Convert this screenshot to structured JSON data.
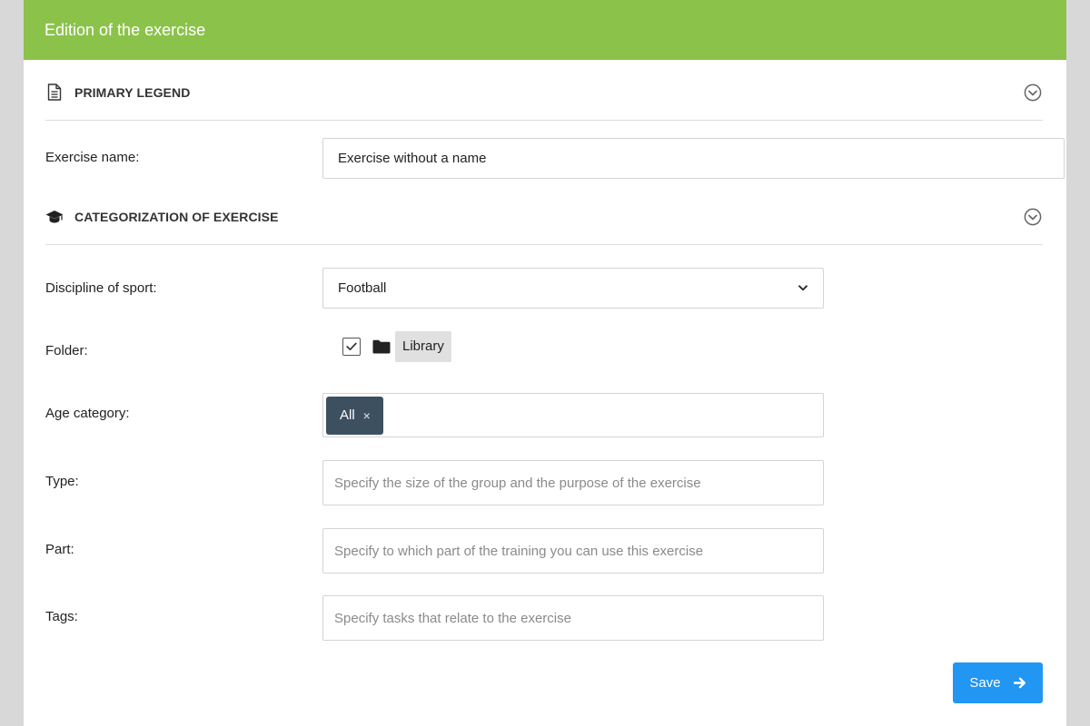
{
  "header": {
    "title": "Edition of the exercise",
    "background_color": "#8bc34a"
  },
  "sections": {
    "primary": {
      "title": "PRIMARY LEGEND",
      "icon": "document-icon",
      "toggle_icon": "chevron-circle-down-icon"
    },
    "categorization": {
      "title": "CATEGORIZATION OF EXERCISE",
      "icon": "graduation-cap-icon",
      "toggle_icon": "chevron-circle-down-icon"
    }
  },
  "fields": {
    "exercise_name": {
      "label": "Exercise name:",
      "value": "Exercise without a name"
    },
    "discipline": {
      "label": "Discipline of sport:",
      "selected": "Football",
      "icon": "chevron-down-icon"
    },
    "folder": {
      "label": "Folder:",
      "checked": true,
      "icon": "folder-icon",
      "name": "Library"
    },
    "age_category": {
      "label": "Age category:",
      "chips": [
        {
          "label": "All",
          "remove": "×"
        }
      ],
      "chip_color": "#3d5060"
    },
    "type": {
      "label": "Type:",
      "placeholder": "Specify the size of the group and the purpose of the exercise"
    },
    "part": {
      "label": "Part:",
      "placeholder": "Specify to which part of the training you can use this exercise"
    },
    "tags": {
      "label": "Tags:",
      "placeholder": "Specify tasks that relate to the exercise"
    }
  },
  "actions": {
    "save_label": "Save",
    "save_icon": "arrow-right-icon",
    "save_color": "#2196f3"
  }
}
